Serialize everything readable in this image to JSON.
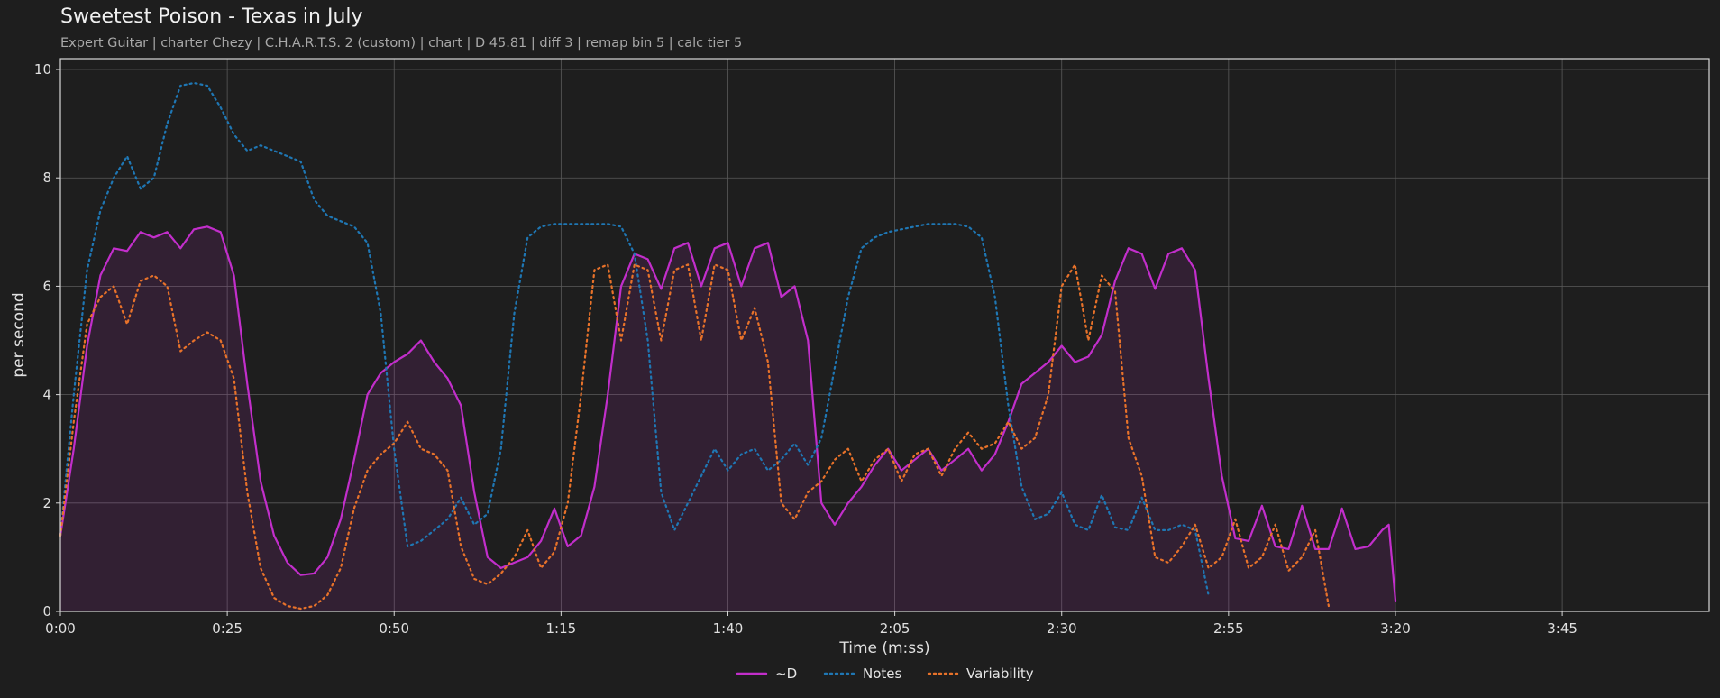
{
  "title": "Sweetest Poison - Texas in July",
  "subtitle": "Expert Guitar  |  charter Chezy  |  C.H.A.R.T.S. 2 (custom)  |  chart  |  D 45.81  |  diff 3  |  remap bin 5  |  calc tier 5",
  "chart_data": {
    "type": "line",
    "xlabel": "Time (m:ss)",
    "ylabel": "per second",
    "xlim": [
      0,
      247
    ],
    "ylim": [
      0,
      10.2
    ],
    "grid": true,
    "legend_position": "bottom-center",
    "x_ticks": [
      {
        "value": 0,
        "label": "0:00"
      },
      {
        "value": 25,
        "label": "0:25"
      },
      {
        "value": 50,
        "label": "0:50"
      },
      {
        "value": 75,
        "label": "1:15"
      },
      {
        "value": 100,
        "label": "1:40"
      },
      {
        "value": 125,
        "label": "2:05"
      },
      {
        "value": 150,
        "label": "2:30"
      },
      {
        "value": 175,
        "label": "2:55"
      },
      {
        "value": 200,
        "label": "3:20"
      },
      {
        "value": 225,
        "label": "3:45"
      }
    ],
    "y_ticks": [
      {
        "value": 0,
        "label": "0"
      },
      {
        "value": 2,
        "label": "2"
      },
      {
        "value": 4,
        "label": "4"
      },
      {
        "value": 6,
        "label": "6"
      },
      {
        "value": 8,
        "label": "8"
      },
      {
        "value": 10,
        "label": "10"
      }
    ],
    "series": [
      {
        "name": "~D",
        "color": "#c22ecb",
        "style": "solid",
        "fill": true,
        "points": [
          [
            0,
            1.4
          ],
          [
            2,
            3.0
          ],
          [
            4,
            4.9
          ],
          [
            6,
            6.2
          ],
          [
            8,
            6.7
          ],
          [
            10,
            6.65
          ],
          [
            12,
            7.0
          ],
          [
            14,
            6.9
          ],
          [
            16,
            7.0
          ],
          [
            18,
            6.7
          ],
          [
            20,
            7.05
          ],
          [
            22,
            7.1
          ],
          [
            24,
            7.0
          ],
          [
            26,
            6.2
          ],
          [
            28,
            4.2
          ],
          [
            30,
            2.4
          ],
          [
            32,
            1.4
          ],
          [
            34,
            0.9
          ],
          [
            36,
            0.67
          ],
          [
            38,
            0.7
          ],
          [
            40,
            1.0
          ],
          [
            42,
            1.7
          ],
          [
            44,
            2.8
          ],
          [
            46,
            4.0
          ],
          [
            48,
            4.4
          ],
          [
            50,
            4.6
          ],
          [
            52,
            4.75
          ],
          [
            54,
            5.0
          ],
          [
            56,
            4.6
          ],
          [
            58,
            4.3
          ],
          [
            60,
            3.8
          ],
          [
            62,
            2.2
          ],
          [
            64,
            1.0
          ],
          [
            66,
            0.8
          ],
          [
            68,
            0.9
          ],
          [
            70,
            1.0
          ],
          [
            72,
            1.3
          ],
          [
            74,
            1.9
          ],
          [
            76,
            1.2
          ],
          [
            78,
            1.4
          ],
          [
            80,
            2.3
          ],
          [
            82,
            4.0
          ],
          [
            84,
            6.0
          ],
          [
            86,
            6.6
          ],
          [
            88,
            6.5
          ],
          [
            90,
            5.95
          ],
          [
            92,
            6.7
          ],
          [
            94,
            6.8
          ],
          [
            96,
            6.0
          ],
          [
            98,
            6.7
          ],
          [
            100,
            6.8
          ],
          [
            102,
            6.0
          ],
          [
            104,
            6.7
          ],
          [
            106,
            6.8
          ],
          [
            108,
            5.8
          ],
          [
            110,
            6.0
          ],
          [
            112,
            5.0
          ],
          [
            114,
            2.0
          ],
          [
            116,
            1.6
          ],
          [
            118,
            2.0
          ],
          [
            120,
            2.3
          ],
          [
            122,
            2.7
          ],
          [
            124,
            3.0
          ],
          [
            126,
            2.6
          ],
          [
            128,
            2.8
          ],
          [
            130,
            3.0
          ],
          [
            132,
            2.6
          ],
          [
            134,
            2.8
          ],
          [
            136,
            3.0
          ],
          [
            138,
            2.6
          ],
          [
            140,
            2.9
          ],
          [
            142,
            3.5
          ],
          [
            144,
            4.2
          ],
          [
            146,
            4.4
          ],
          [
            148,
            4.6
          ],
          [
            150,
            4.9
          ],
          [
            152,
            4.6
          ],
          [
            154,
            4.7
          ],
          [
            156,
            5.1
          ],
          [
            158,
            6.1
          ],
          [
            160,
            6.7
          ],
          [
            162,
            6.6
          ],
          [
            164,
            5.95
          ],
          [
            166,
            6.6
          ],
          [
            168,
            6.7
          ],
          [
            170,
            6.3
          ],
          [
            172,
            4.3
          ],
          [
            174,
            2.5
          ],
          [
            176,
            1.35
          ],
          [
            178,
            1.3
          ],
          [
            180,
            1.95
          ],
          [
            182,
            1.2
          ],
          [
            184,
            1.15
          ],
          [
            186,
            1.95
          ],
          [
            188,
            1.15
          ],
          [
            190,
            1.15
          ],
          [
            192,
            1.9
          ],
          [
            194,
            1.15
          ],
          [
            196,
            1.2
          ],
          [
            198,
            1.5
          ],
          [
            199,
            1.6
          ],
          [
            200,
            0.2
          ]
        ]
      },
      {
        "name": "Notes",
        "color": "#1f77b4",
        "style": "dotted",
        "fill": false,
        "points": [
          [
            0,
            1.4
          ],
          [
            2,
            4.0
          ],
          [
            4,
            6.3
          ],
          [
            6,
            7.4
          ],
          [
            8,
            8.0
          ],
          [
            10,
            8.4
          ],
          [
            12,
            7.8
          ],
          [
            14,
            8.0
          ],
          [
            16,
            9.0
          ],
          [
            18,
            9.7
          ],
          [
            20,
            9.75
          ],
          [
            22,
            9.7
          ],
          [
            24,
            9.3
          ],
          [
            26,
            8.8
          ],
          [
            28,
            8.5
          ],
          [
            30,
            8.6
          ],
          [
            32,
            8.5
          ],
          [
            34,
            8.4
          ],
          [
            36,
            8.3
          ],
          [
            38,
            7.6
          ],
          [
            40,
            7.3
          ],
          [
            42,
            7.2
          ],
          [
            44,
            7.1
          ],
          [
            46,
            6.8
          ],
          [
            48,
            5.5
          ],
          [
            50,
            3.0
          ],
          [
            52,
            1.2
          ],
          [
            54,
            1.3
          ],
          [
            56,
            1.5
          ],
          [
            58,
            1.7
          ],
          [
            60,
            2.1
          ],
          [
            62,
            1.6
          ],
          [
            64,
            1.8
          ],
          [
            66,
            3.0
          ],
          [
            68,
            5.5
          ],
          [
            70,
            6.9
          ],
          [
            72,
            7.1
          ],
          [
            74,
            7.15
          ],
          [
            76,
            7.15
          ],
          [
            78,
            7.15
          ],
          [
            80,
            7.15
          ],
          [
            82,
            7.15
          ],
          [
            84,
            7.1
          ],
          [
            86,
            6.6
          ],
          [
            88,
            5.0
          ],
          [
            90,
            2.2
          ],
          [
            92,
            1.5
          ],
          [
            94,
            2.0
          ],
          [
            96,
            2.5
          ],
          [
            98,
            3.0
          ],
          [
            100,
            2.6
          ],
          [
            102,
            2.9
          ],
          [
            104,
            3.0
          ],
          [
            106,
            2.6
          ],
          [
            108,
            2.8
          ],
          [
            110,
            3.1
          ],
          [
            112,
            2.7
          ],
          [
            114,
            3.2
          ],
          [
            116,
            4.5
          ],
          [
            118,
            5.8
          ],
          [
            120,
            6.7
          ],
          [
            122,
            6.9
          ],
          [
            124,
            7.0
          ],
          [
            126,
            7.05
          ],
          [
            128,
            7.1
          ],
          [
            130,
            7.15
          ],
          [
            132,
            7.15
          ],
          [
            134,
            7.15
          ],
          [
            136,
            7.1
          ],
          [
            138,
            6.9
          ],
          [
            140,
            5.8
          ],
          [
            142,
            3.8
          ],
          [
            144,
            2.3
          ],
          [
            146,
            1.7
          ],
          [
            148,
            1.8
          ],
          [
            150,
            2.2
          ],
          [
            152,
            1.6
          ],
          [
            154,
            1.5
          ],
          [
            156,
            2.15
          ],
          [
            158,
            1.55
          ],
          [
            160,
            1.5
          ],
          [
            162,
            2.1
          ],
          [
            164,
            1.5
          ],
          [
            166,
            1.5
          ],
          [
            168,
            1.6
          ],
          [
            170,
            1.5
          ],
          [
            172,
            0.3
          ]
        ]
      },
      {
        "name": "Variability",
        "color": "#e8722a",
        "style": "dotted",
        "fill": false,
        "points": [
          [
            0,
            1.4
          ],
          [
            2,
            3.5
          ],
          [
            4,
            5.3
          ],
          [
            6,
            5.8
          ],
          [
            8,
            6.0
          ],
          [
            10,
            5.3
          ],
          [
            12,
            6.1
          ],
          [
            14,
            6.2
          ],
          [
            16,
            6.0
          ],
          [
            18,
            4.8
          ],
          [
            20,
            5.0
          ],
          [
            22,
            5.15
          ],
          [
            24,
            5.0
          ],
          [
            26,
            4.3
          ],
          [
            28,
            2.2
          ],
          [
            30,
            0.8
          ],
          [
            32,
            0.25
          ],
          [
            34,
            0.1
          ],
          [
            36,
            0.05
          ],
          [
            38,
            0.1
          ],
          [
            40,
            0.3
          ],
          [
            42,
            0.8
          ],
          [
            44,
            1.9
          ],
          [
            46,
            2.6
          ],
          [
            48,
            2.9
          ],
          [
            50,
            3.1
          ],
          [
            52,
            3.5
          ],
          [
            54,
            3.0
          ],
          [
            56,
            2.9
          ],
          [
            58,
            2.6
          ],
          [
            60,
            1.2
          ],
          [
            62,
            0.6
          ],
          [
            64,
            0.5
          ],
          [
            66,
            0.7
          ],
          [
            68,
            1.0
          ],
          [
            70,
            1.5
          ],
          [
            72,
            0.8
          ],
          [
            74,
            1.1
          ],
          [
            76,
            2.0
          ],
          [
            78,
            4.0
          ],
          [
            80,
            6.3
          ],
          [
            82,
            6.4
          ],
          [
            84,
            5.0
          ],
          [
            86,
            6.4
          ],
          [
            88,
            6.3
          ],
          [
            90,
            5.0
          ],
          [
            92,
            6.3
          ],
          [
            94,
            6.4
          ],
          [
            96,
            5.0
          ],
          [
            98,
            6.4
          ],
          [
            100,
            6.3
          ],
          [
            102,
            5.0
          ],
          [
            104,
            5.6
          ],
          [
            106,
            4.6
          ],
          [
            108,
            2.0
          ],
          [
            110,
            1.7
          ],
          [
            112,
            2.2
          ],
          [
            114,
            2.4
          ],
          [
            116,
            2.8
          ],
          [
            118,
            3.0
          ],
          [
            120,
            2.4
          ],
          [
            122,
            2.8
          ],
          [
            124,
            3.0
          ],
          [
            126,
            2.4
          ],
          [
            128,
            2.9
          ],
          [
            130,
            3.0
          ],
          [
            132,
            2.5
          ],
          [
            134,
            3.0
          ],
          [
            136,
            3.3
          ],
          [
            138,
            3.0
          ],
          [
            140,
            3.1
          ],
          [
            142,
            3.5
          ],
          [
            144,
            3.0
          ],
          [
            146,
            3.2
          ],
          [
            148,
            4.0
          ],
          [
            150,
            6.0
          ],
          [
            152,
            6.4
          ],
          [
            154,
            5.0
          ],
          [
            156,
            6.2
          ],
          [
            158,
            5.9
          ],
          [
            160,
            3.2
          ],
          [
            162,
            2.5
          ],
          [
            164,
            1.0
          ],
          [
            166,
            0.9
          ],
          [
            168,
            1.2
          ],
          [
            170,
            1.6
          ],
          [
            172,
            0.8
          ],
          [
            174,
            1.0
          ],
          [
            176,
            1.7
          ],
          [
            178,
            0.8
          ],
          [
            180,
            1.0
          ],
          [
            182,
            1.6
          ],
          [
            184,
            0.75
          ],
          [
            186,
            1.0
          ],
          [
            188,
            1.5
          ],
          [
            190,
            0.1
          ]
        ]
      }
    ]
  }
}
